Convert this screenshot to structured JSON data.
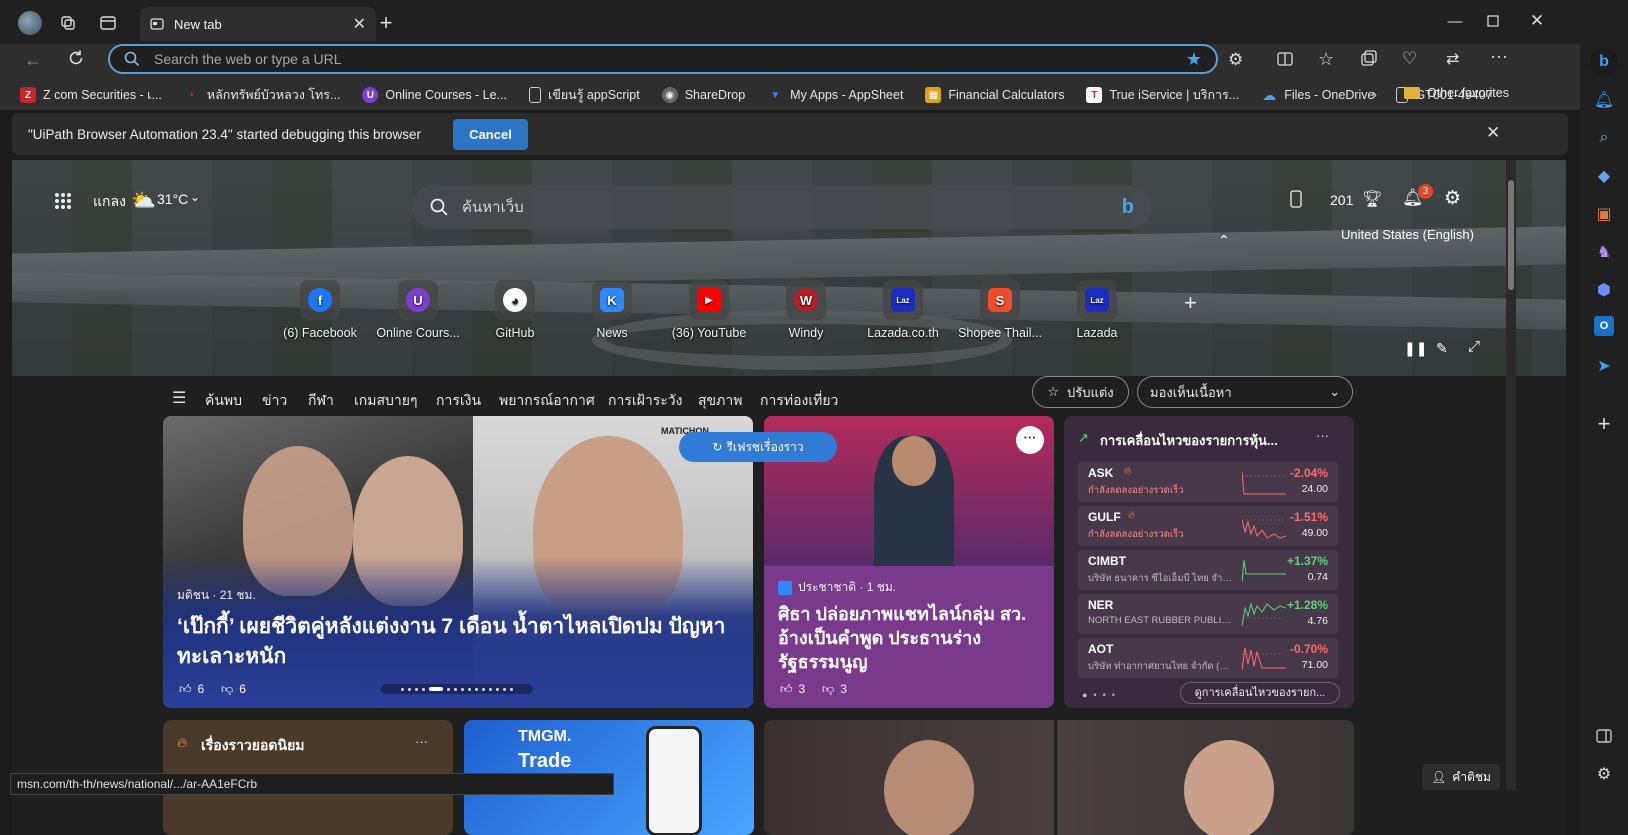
{
  "browser": {
    "tab_title": "New tab",
    "address_placeholder": "Search the web or type a URL"
  },
  "favorites": [
    {
      "label": "Z com Securities - เ...",
      "color": "#c8262d",
      "icon": "Z"
    },
    {
      "label": "หลักทรัพย์บัวหลวง โทร...",
      "color": "#c41e3a",
      "icon": "•"
    },
    {
      "label": "Online Courses - Le...",
      "color": "#7a3fd0",
      "icon": "U"
    },
    {
      "label": "เขียนรู้ appScript",
      "color": "#555",
      "icon": "▯"
    },
    {
      "label": "ShareDrop",
      "color": "#444",
      "icon": "◉"
    },
    {
      "label": "My Apps - AppSheet",
      "color": "#3b5bd6",
      "icon": "▼"
    },
    {
      "label": "Financial Calculators",
      "color": "#d9a520",
      "icon": "▦"
    },
    {
      "label": "True iService | บริการ...",
      "color": "#c8262d",
      "icon": "T"
    },
    {
      "label": "Files - OneDrive",
      "color": "#2f7bd6",
      "icon": "☁"
    },
    {
      "label": "GT001-49407",
      "color": "#555",
      "icon": "▯"
    }
  ],
  "favorites_other": "Other favorites",
  "infobar": {
    "message": "\"UiPath Browser Automation 23.4\" started debugging this browser",
    "cancel_label": "Cancel"
  },
  "newtab": {
    "location": "แกลง",
    "temperature": "31°C",
    "search_placeholder": "ค้นหาเว็บ",
    "rewards_points": "201",
    "notification_count": "3",
    "language": "United States (English)",
    "quick_links": [
      {
        "label": "(6) Facebook",
        "color": "#1877f2",
        "icon": "f"
      },
      {
        "label": "Online Cours...",
        "color": "#7a3fd0",
        "icon": "U"
      },
      {
        "label": "GitHub",
        "color": "#222",
        "icon": "◕"
      },
      {
        "label": "News",
        "color": "#2f88ff",
        "icon": "K"
      },
      {
        "label": "(36) YouTube",
        "color": "#ff0000",
        "icon": "▶"
      },
      {
        "label": "Windy",
        "color": "#b0212b",
        "icon": "W"
      },
      {
        "label": "Lazada.co.th",
        "color": "#1a2dbf",
        "icon": "Laz"
      },
      {
        "label": "Shopee Thail...",
        "color": "#ee4d2d",
        "icon": "S"
      },
      {
        "label": "Lazada",
        "color": "#1a2dbf",
        "icon": "Laz"
      }
    ],
    "feed_tabs": [
      "ค้นพบ",
      "ข่าว",
      "กีฬา",
      "เกมสบายๆ",
      "การเงิน",
      "พยากรณ์อากาศ",
      "การเฝ้าระวัง",
      "สุขภาพ",
      "การท่องเที่ยว"
    ],
    "personalize_label": "ปรับแต่ง",
    "content_visibility": "มองเห็นเนื้อหา",
    "refresh_label": "รีเฟรชเรื่องราว"
  },
  "card_main": {
    "source": "มติชน · 21 ชม.",
    "headline": "‘เป๊กกี้’ เผยชีวิตคู่หลังแต่งงาน 7 เดือน น้ำตาไหลเปิดปม ปัญหาทะเลาะหนัก",
    "likes": "6",
    "dislikes": "6",
    "watermark": "MATICHON"
  },
  "card_side": {
    "source": "ประชาชาติ · 1 ชม.",
    "headline": "ศิธา ปล่อยภาพแชทไลน์กลุ่ม สว. อ้างเป็นคำพูด ประธานร่างรัฐธรรมนูญ",
    "likes": "3",
    "dislikes": "3"
  },
  "stocks": {
    "title": "การเคลื่อนไหวของรายการหุ้น...",
    "footer_link": "ดูการเคลื่อนไหวของรายก...",
    "rows": [
      {
        "symbol": "ASK",
        "sub": "กำลังลดลงอย่างรวดเร็ว",
        "change": "-2.04%",
        "price": "24.00",
        "up": false
      },
      {
        "symbol": "GULF",
        "sub": "กำลังลดลงอย่างรวดเร็ว",
        "change": "-1.51%",
        "price": "49.00",
        "up": false
      },
      {
        "symbol": "CIMBT",
        "sub": "บริษัท ธนาคาร ซีไอเอ็มบี ไทย จำกั...",
        "change": "+1.37%",
        "price": "0.74",
        "up": true
      },
      {
        "symbol": "NER",
        "sub": "NORTH EAST RUBBER PUBLIC C...",
        "change": "+1.28%",
        "price": "4.76",
        "up": true
      },
      {
        "symbol": "AOT",
        "sub": "บริษัท ท่าอากาศยานไทย จำกัด (ม...",
        "change": "-0.70%",
        "price": "71.00",
        "up": false
      }
    ]
  },
  "trending": {
    "title": "เรื่องราวยอดนิยม"
  },
  "ad": {
    "brand": "TMGM.",
    "tagline": "Trade"
  },
  "feedback_label": "คำติชม",
  "status_url": "msn.com/th-th/news/national/.../ar-AA1eFCrb",
  "colors": {
    "accent": "#5c9fd6",
    "down": "#ff6b6b",
    "up": "#5fd37a"
  }
}
